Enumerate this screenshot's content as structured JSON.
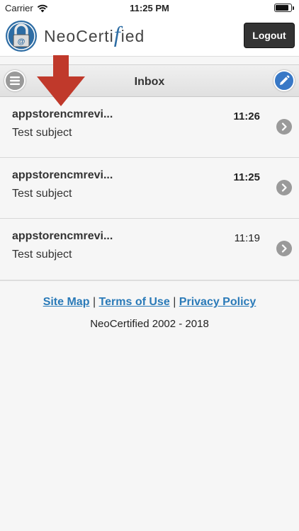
{
  "status_bar": {
    "carrier": "Carrier",
    "time": "11:25 PM"
  },
  "header": {
    "brand": {
      "neo": "Neo",
      "cert": "Certi",
      "f": "f",
      "ied": "ied"
    },
    "logout_label": "Logout"
  },
  "inbox": {
    "title": "Inbox"
  },
  "messages": [
    {
      "sender": "appstorencmrevi...",
      "subject": "Test subject",
      "time": "11:26"
    },
    {
      "sender": "appstorencmrevi...",
      "subject": "Test subject",
      "time": "11:25"
    },
    {
      "sender": "appstorencmrevi...",
      "subject": "Test subject",
      "time": "11:19"
    }
  ],
  "footer": {
    "site_map": "Site Map",
    "separator": "|",
    "terms": "Terms of Use",
    "privacy": "Privacy Policy",
    "copyright": "NeoCertified 2002 - 2018"
  },
  "colors": {
    "accent_blue": "#3878c6",
    "link": "#2a7ab8",
    "arrow_red": "#c0392b",
    "logo_blue": "#2e6da4"
  }
}
